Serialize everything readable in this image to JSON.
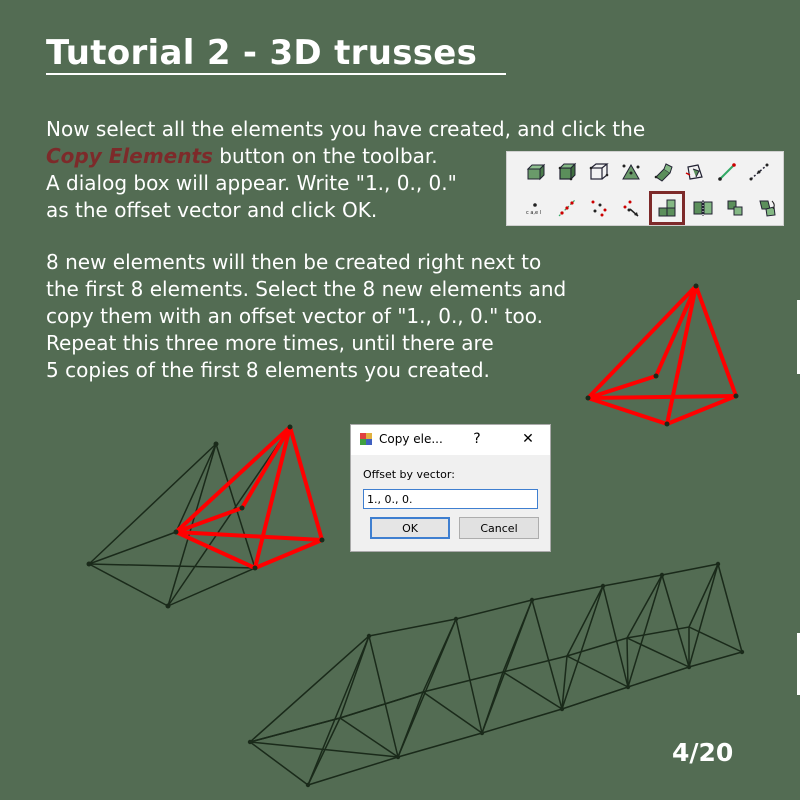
{
  "slide": {
    "title": "Tutorial 2 - 3D trusses",
    "page_number": "4/20"
  },
  "paragraph1": {
    "line1": "Now select all the elements you have created, and click the",
    "highlight": "Copy Elements",
    "line2_rest": " button on the toolbar.",
    "line3": "A dialog box will appear. Write \"1., 0., 0.\"",
    "line4": "as the offset vector and click OK."
  },
  "paragraph2": {
    "line1": "8 new elements will then be created right next to",
    "line2": "the first 8 elements. Select the 8 new elements and",
    "line3": "copy them with an offset vector of \"1., 0., 0.\" too.",
    "line4": "Repeat this three more times, until there are",
    "line5": "5 copies of the first 8 elements you created."
  },
  "toolbar": {
    "row1_icons": [
      "mesh-block-icon",
      "element-cube-icon",
      "element-cube-wire-icon",
      "node-triangle-icon",
      "element-extrude-icon",
      "element-copy-wire-icon",
      "line-diagonal-icon",
      "line-dotted-icon"
    ],
    "row2_icons": [
      "nodes-label-icon",
      "nodes-diagonal-icon",
      "nodes-scatter-icon",
      "nodes-arrow-icon",
      "copy-elements-icon",
      "mirror-elements-icon",
      "move-elements-icon",
      "rotate-elements-icon"
    ],
    "selected": "copy-elements-icon",
    "highlight_color": "#7d2a2a"
  },
  "dialog": {
    "title": "Copy ele...",
    "help": "?",
    "close": "✕",
    "label": "Offset by vector:",
    "value": "1., 0., 0.",
    "ok": "OK",
    "cancel": "Cancel"
  },
  "colors": {
    "background": "#536c53",
    "truss_red": "#ff0000",
    "truss_dark": "#1a2a1a"
  }
}
